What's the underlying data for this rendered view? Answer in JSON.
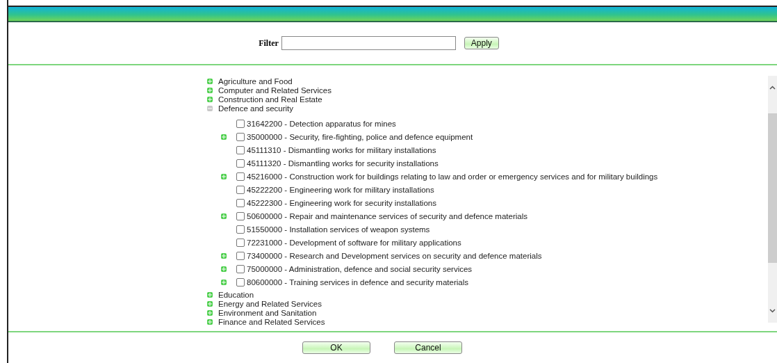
{
  "filter": {
    "label": "Filter",
    "button": "Apply"
  },
  "tree": [
    {
      "label": "Agriculture and Food",
      "expanded": false
    },
    {
      "label": "Computer and Related Services",
      "expanded": false
    },
    {
      "label": "Construction and Real Estate",
      "expanded": false
    },
    {
      "label": "Defence and security",
      "expanded": true,
      "children": [
        {
          "label": "31642200 - Detection apparatus for mines",
          "kind": "leaf",
          "checked": false
        },
        {
          "label": "35000000 - Security, fire-fighting, police and defence equipment",
          "kind": "branch",
          "checked": false
        },
        {
          "label": "45111310 - Dismantling works for military installations",
          "kind": "leaf",
          "checked": false
        },
        {
          "label": "45111320 - Dismantling works for security installations",
          "kind": "leaf",
          "checked": false
        },
        {
          "label": "45216000 - Construction work for buildings relating to law and order or emergency services and for military buildings",
          "kind": "branch",
          "checked": false
        },
        {
          "label": "45222200 - Engineering work for military installations",
          "kind": "leaf",
          "checked": false
        },
        {
          "label": "45222300 - Engineering work for security installations",
          "kind": "leaf",
          "checked": false
        },
        {
          "label": "50600000 - Repair and maintenance services of security and defence materials",
          "kind": "branch",
          "checked": false
        },
        {
          "label": "51550000 - Installation services of weapon systems",
          "kind": "leaf",
          "checked": false
        },
        {
          "label": "72231000 - Development of software for military applications",
          "kind": "leaf",
          "checked": false
        },
        {
          "label": "73400000 - Research and Development services on security and defence materials",
          "kind": "branch",
          "checked": false
        },
        {
          "label": "75000000 - Administration, defence and social security services",
          "kind": "branch",
          "checked": false
        },
        {
          "label": "80600000 - Training services in defence and security materials",
          "kind": "branch",
          "checked": false
        }
      ]
    },
    {
      "label": "Education",
      "expanded": false
    },
    {
      "label": "Energy and Related Services",
      "expanded": false
    },
    {
      "label": "Environment and Sanitation",
      "expanded": false
    },
    {
      "label": "Finance and Related Services",
      "expanded": false
    }
  ],
  "buttons": [
    "OK",
    "Cancel"
  ]
}
